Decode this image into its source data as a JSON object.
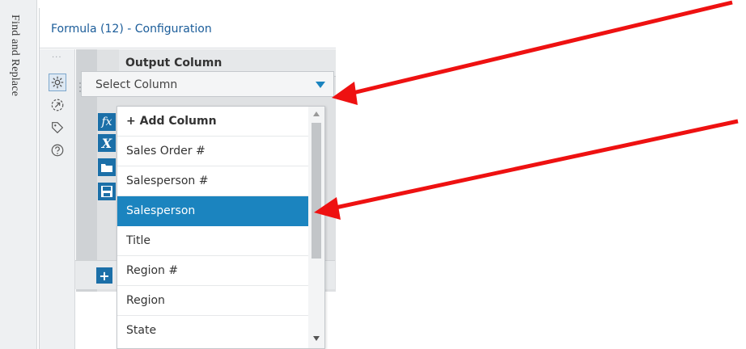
{
  "side_tab": {
    "label": "Find and Replace"
  },
  "config": {
    "title": "Formula (12) - Configuration",
    "rail_dots": "...",
    "rail_icons": [
      "gear-icon",
      "navigate-icon",
      "tag-icon",
      "help-icon"
    ]
  },
  "grid": {
    "column_header": "Output Column",
    "select_value": "Select Column",
    "formula_icons": [
      "fx-icon",
      "variable-icon",
      "folder-icon",
      "save-icon"
    ],
    "add_icon": "+"
  },
  "dropdown": {
    "items": [
      {
        "label": "+ Add Column",
        "bold": true,
        "selected": false
      },
      {
        "label": "Sales Order #",
        "bold": false,
        "selected": false
      },
      {
        "label": "Salesperson #",
        "bold": false,
        "selected": false
      },
      {
        "label": "Salesperson",
        "bold": false,
        "selected": true
      },
      {
        "label": "Title",
        "bold": false,
        "selected": false
      },
      {
        "label": "Region #",
        "bold": false,
        "selected": false
      },
      {
        "label": "Region",
        "bold": false,
        "selected": false
      },
      {
        "label": "State",
        "bold": false,
        "selected": false
      }
    ]
  },
  "colors": {
    "accent": "#1b84bf",
    "title": "#1a5c99",
    "annotation_arrow": "#ee1111"
  }
}
